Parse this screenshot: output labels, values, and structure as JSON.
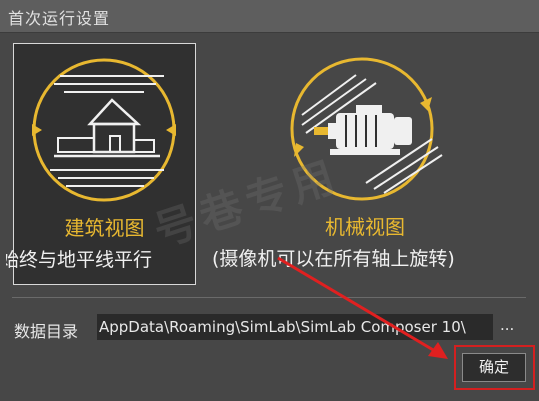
{
  "window": {
    "title": "首次运行设置"
  },
  "views": [
    {
      "label": "建筑视图",
      "description": "始终与地平线平行",
      "selected": true,
      "icon": "house-icon"
    },
    {
      "label": "机械视图",
      "description": "(摄像机可以在所有轴上旋转)",
      "selected": false,
      "icon": "motor-icon"
    }
  ],
  "data_dir": {
    "label": "数据目录",
    "value": "AppData\\Roaming\\SimLab\\SimLab Composer 10\\",
    "browse_label": "..."
  },
  "buttons": {
    "ok": "确定"
  },
  "watermark": "号巷专用",
  "colors": {
    "accent": "#e8b830",
    "highlight_frame": "#d42020"
  }
}
